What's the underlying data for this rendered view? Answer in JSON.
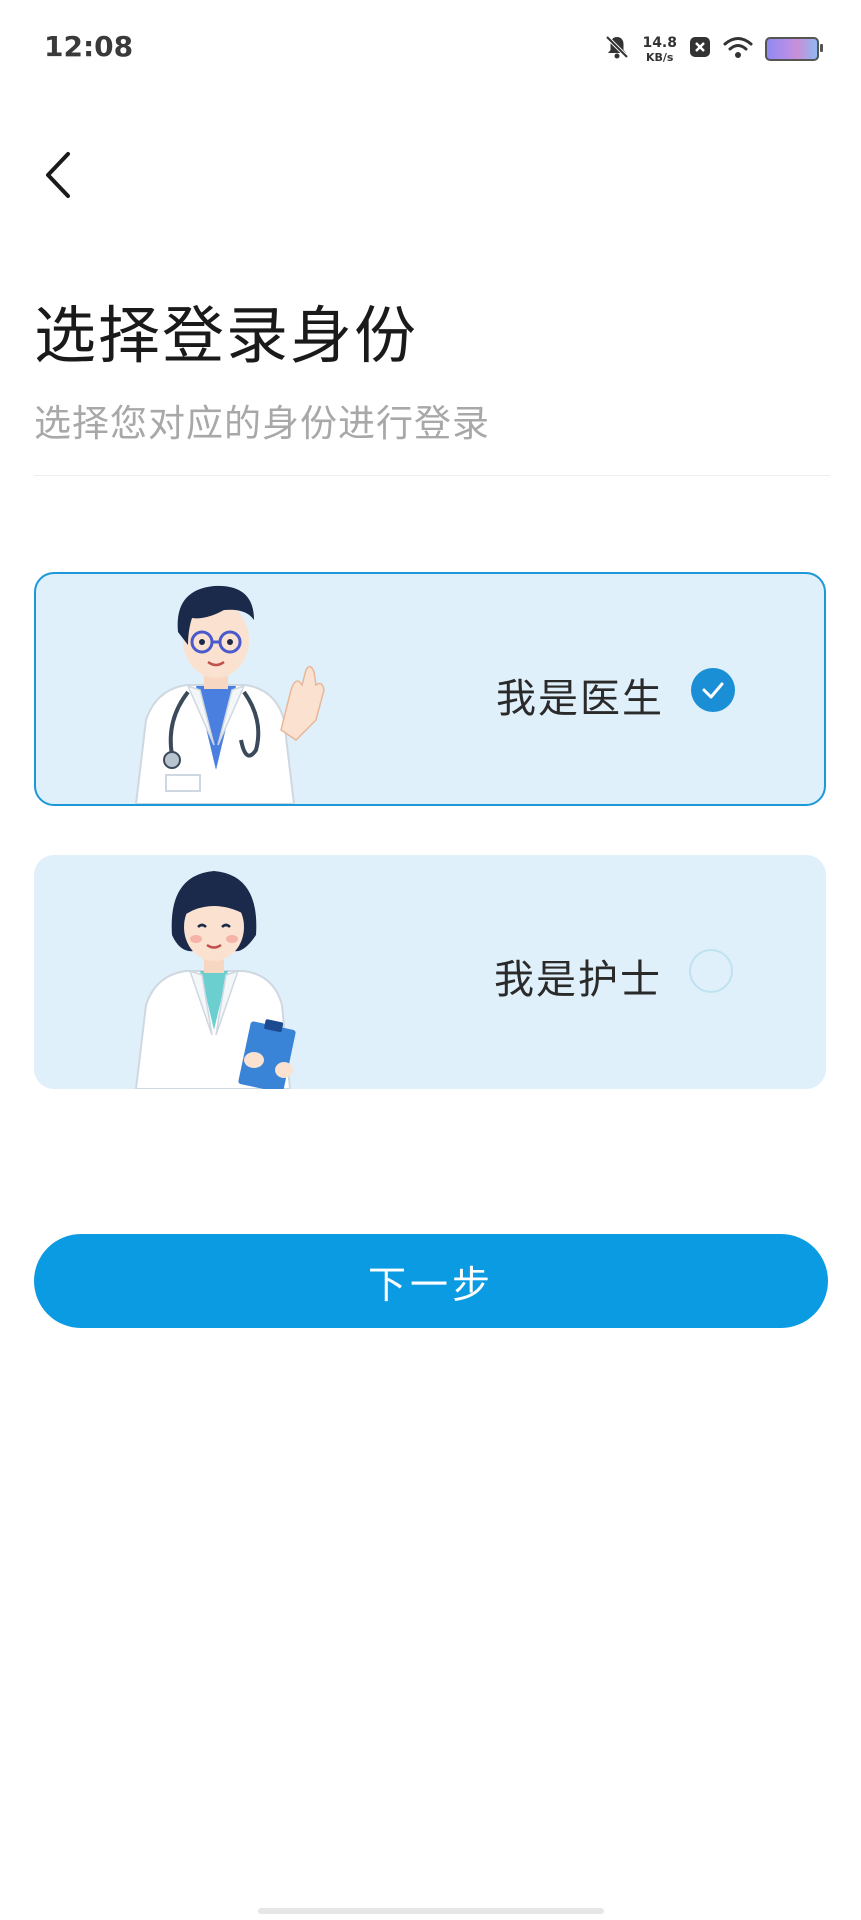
{
  "status_bar": {
    "time": "12:08",
    "net_speed_value": "14.8",
    "net_speed_unit": "KB/s",
    "icons": [
      "bell-muted-icon",
      "close-box-icon",
      "wifi-icon",
      "battery-icon"
    ]
  },
  "header": {
    "back_icon": "chevron-left-icon",
    "title": "选择登录身份",
    "subtitle": "选择您对应的身份进行登录"
  },
  "roles": [
    {
      "label": "我是医生",
      "selected": true,
      "illustration": "doctor-illustration"
    },
    {
      "label": "我是护士",
      "selected": false,
      "illustration": "nurse-illustration"
    }
  ],
  "next_button": {
    "label": "下一步"
  },
  "colors": {
    "primary": "#0a9be3",
    "card_background": "#dff0fb",
    "selected_border": "#1a98d8",
    "subtitle_text": "#a8a8a8",
    "title_text": "#1a1a1a"
  }
}
